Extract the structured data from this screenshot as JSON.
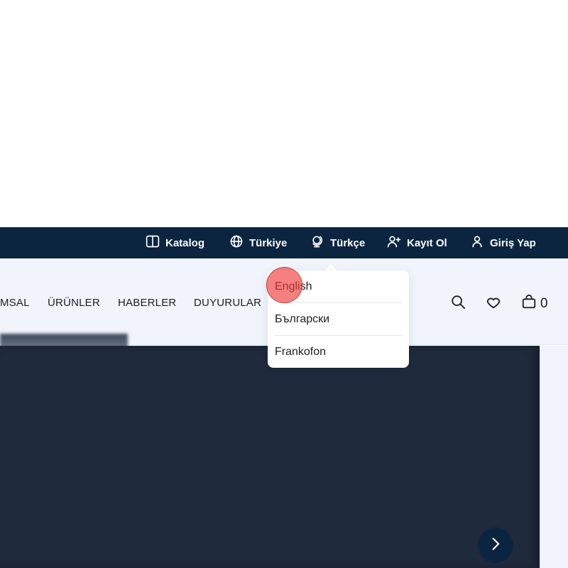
{
  "topbar": {
    "items": [
      {
        "label": "Katalog",
        "icon": "book-icon"
      },
      {
        "label": "Türkiye",
        "icon": "globe-icon"
      },
      {
        "label": "Türkçe",
        "icon": "globe-stand-icon"
      },
      {
        "label": "Kayıt Ol",
        "icon": "user-plus-icon"
      },
      {
        "label": "Giriş Yap",
        "icon": "user-icon"
      }
    ]
  },
  "nav": {
    "links": [
      "MSAL",
      "ÜRÜNLER",
      "HABERLER",
      "DUYURULAR"
    ],
    "cart_count": "0"
  },
  "language_dropdown": {
    "options": [
      "English",
      "Български",
      "Frankofon"
    ]
  },
  "colors": {
    "topbar_bg": "#0b2540",
    "navbar_bg": "#f1f4fa",
    "hero_bg": "#1f2a3d"
  }
}
